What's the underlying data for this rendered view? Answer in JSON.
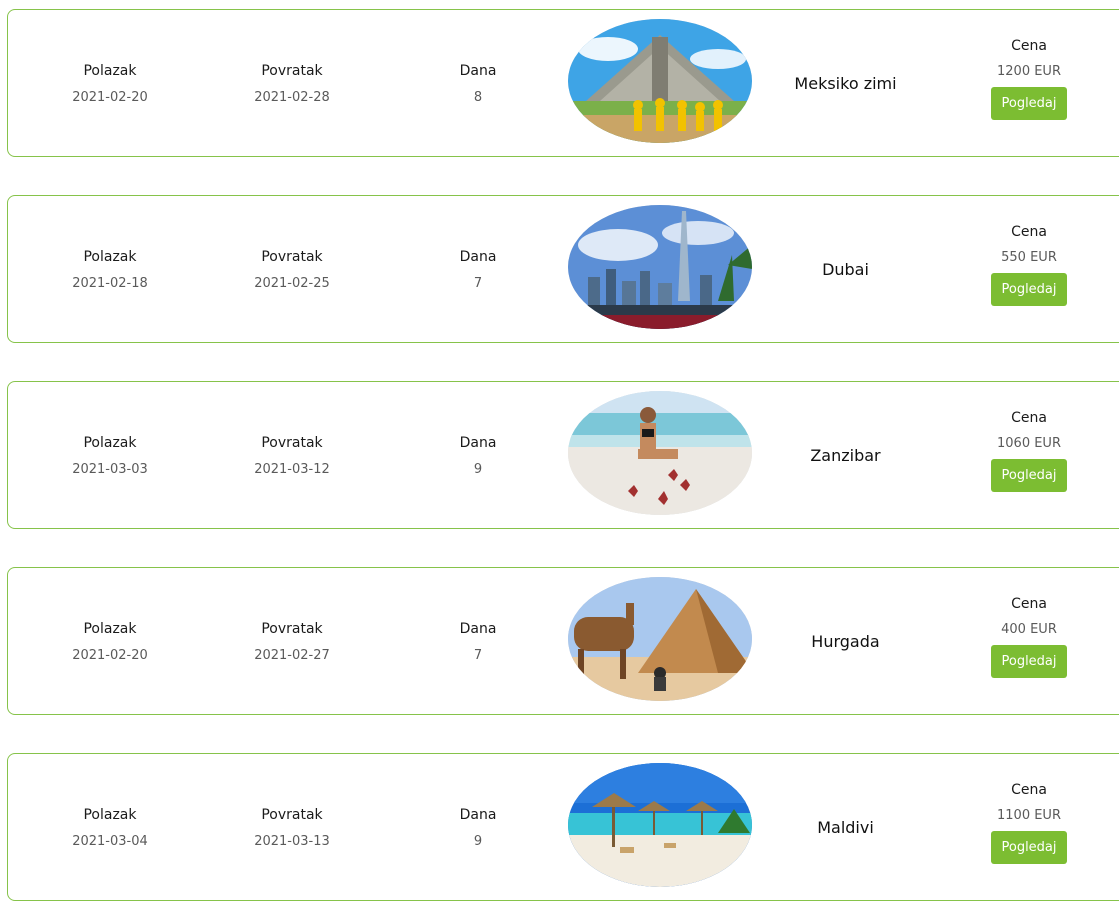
{
  "labels": {
    "departure": "Polazak",
    "return": "Povratak",
    "days": "Dana",
    "price": "Cena",
    "view_button": "Pogledaj"
  },
  "trips": [
    {
      "departure": "2021-02-20",
      "return": "2021-02-28",
      "days": "8",
      "destination": "Meksiko zimi",
      "price": "1200 EUR",
      "photo": "mayan-pyramid"
    },
    {
      "departure": "2021-02-18",
      "return": "2021-02-25",
      "days": "7",
      "destination": "Dubai",
      "price": "550 EUR",
      "photo": "city-skyline"
    },
    {
      "departure": "2021-03-03",
      "return": "2021-03-12",
      "days": "9",
      "destination": "Zanzibar",
      "price": "1060 EUR",
      "photo": "beach-starfish"
    },
    {
      "departure": "2021-02-20",
      "return": "2021-02-27",
      "days": "7",
      "destination": "Hurgada",
      "price": "400 EUR",
      "photo": "camel-pyramid"
    },
    {
      "departure": "2021-03-04",
      "return": "2021-03-13",
      "days": "9",
      "destination": "Maldivi",
      "price": "1100 EUR",
      "photo": "beach-umbrellas"
    }
  ],
  "colors": {
    "accent": "#7cbd32",
    "card_border": "#86c34a"
  }
}
